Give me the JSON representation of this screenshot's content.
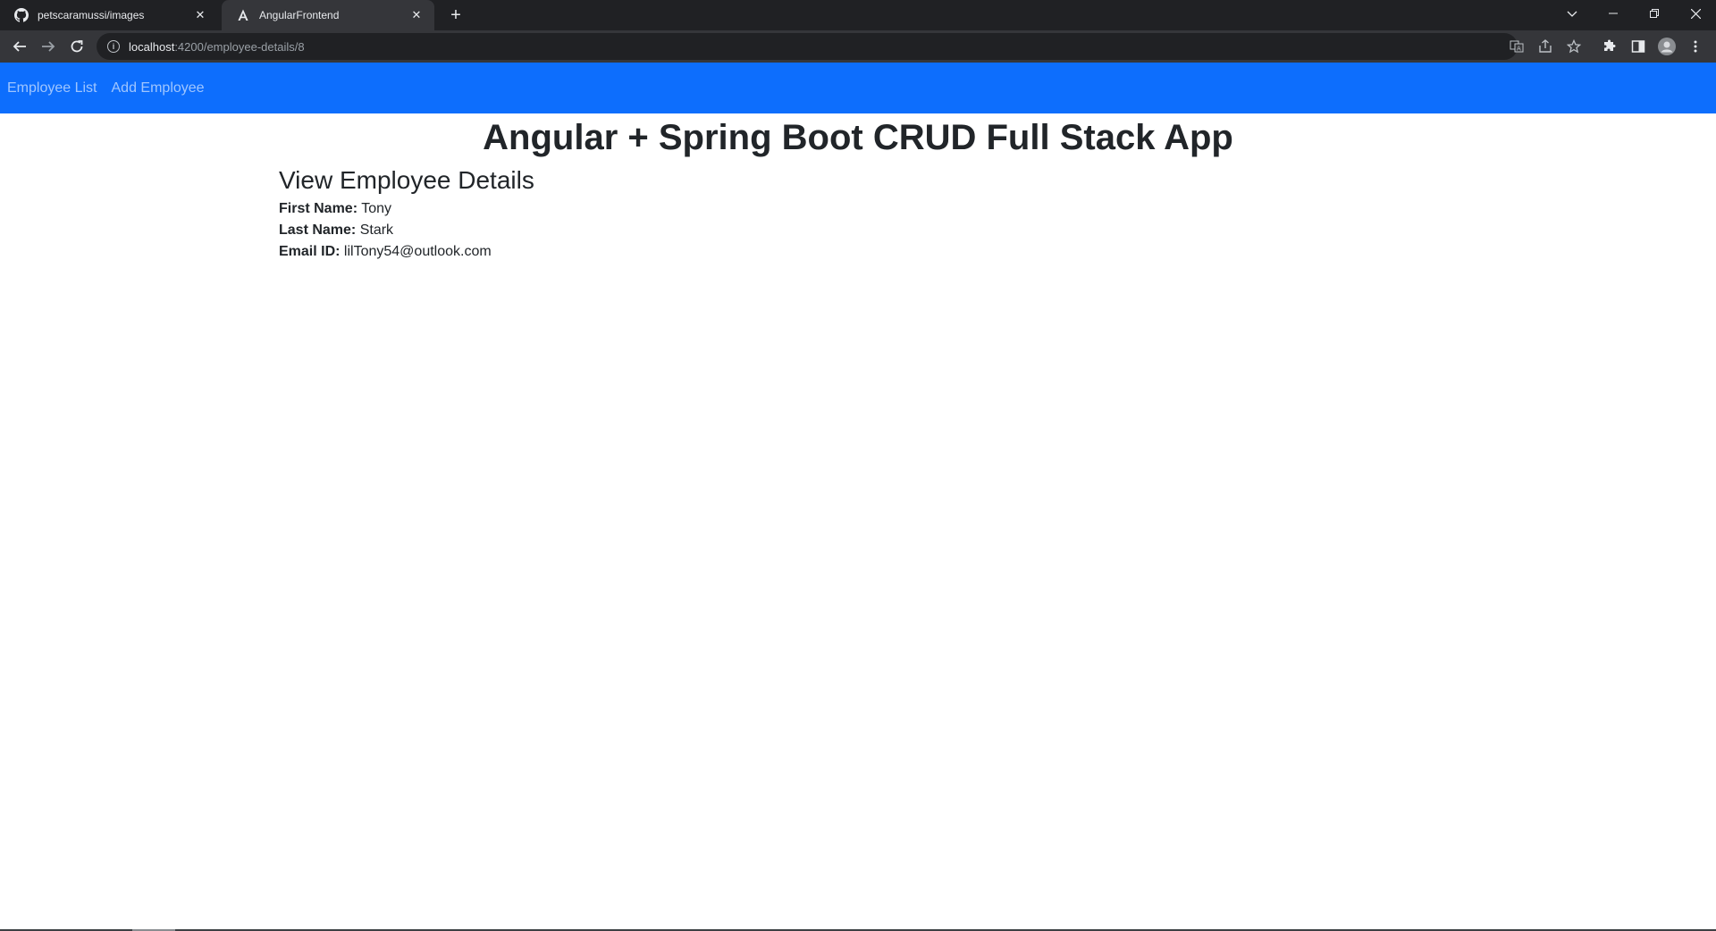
{
  "browser": {
    "tabs": [
      {
        "title": "petscaramussi/images",
        "favicon": "github-icon",
        "active": false
      },
      {
        "title": "AngularFrontend",
        "favicon": "angular-icon",
        "active": true
      }
    ],
    "address": {
      "host": "localhost",
      "path": ":4200/employee-details/8"
    }
  },
  "navbar": {
    "links": [
      {
        "label": "Employee List"
      },
      {
        "label": "Add Employee"
      }
    ],
    "color": "#0d6efd"
  },
  "page": {
    "title": "Angular + Spring Boot CRUD Full Stack App",
    "section_title": "View Employee Details",
    "fields": [
      {
        "label": "First Name:",
        "value": "Tony"
      },
      {
        "label": "Last Name:",
        "value": "Stark"
      },
      {
        "label": "Email ID:",
        "value": "lilTony54@outlook.com"
      }
    ]
  }
}
